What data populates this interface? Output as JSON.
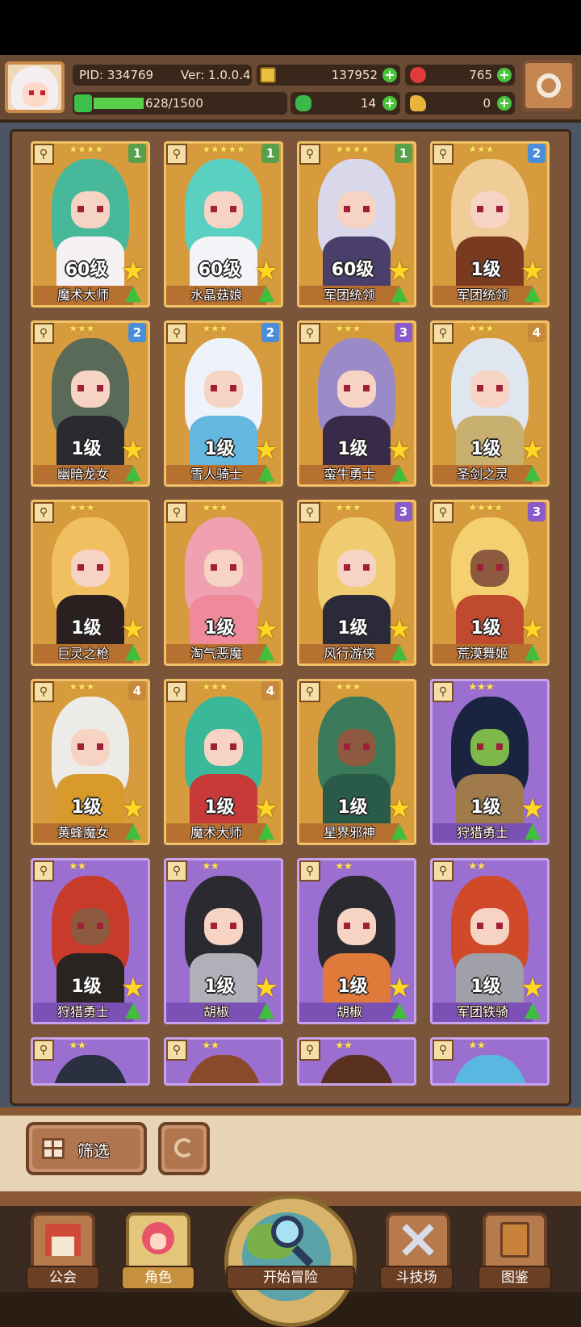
{
  "header": {
    "pid": "PID: 334769",
    "version": "Ver: 1.0.0.4",
    "gold": "137952",
    "gems": "765",
    "energy": "628/1500",
    "energy_fraction": 0.42,
    "clover": "14",
    "keys": "0"
  },
  "cards": [
    {
      "name": "魔术大师",
      "level": "60级",
      "tier": "1",
      "stars": "★★★★",
      "frame": "gold",
      "tier_color": "#58a04a",
      "hair": "#48b89a",
      "body": "#f4f0f4",
      "skin": "light"
    },
    {
      "name": "水晶菇娘",
      "level": "60级",
      "tier": "1",
      "stars": "★★★★★",
      "frame": "gold",
      "tier_color": "#58a04a",
      "hair": "#5ad0c0",
      "body": "#f4f4f8",
      "skin": "light"
    },
    {
      "name": "军团统领",
      "level": "60级",
      "tier": "1",
      "stars": "★★★★",
      "frame": "gold",
      "tier_color": "#58a04a",
      "hair": "#d8d8ea",
      "body": "#4a3f6a",
      "skin": "light"
    },
    {
      "name": "军团统领",
      "level": "1级",
      "tier": "2",
      "stars": "★★★",
      "frame": "gold",
      "tier_color": "#4a8ed8",
      "hair": "#f0cc96",
      "body": "#7a3a20",
      "skin": "light"
    },
    {
      "name": "幽暗龙女",
      "level": "1级",
      "tier": "2",
      "stars": "★★★",
      "frame": "gold",
      "tier_color": "#4a8ed8",
      "hair": "#5a6a58",
      "body": "#2a2a30",
      "skin": "light"
    },
    {
      "name": "雪人骑士",
      "level": "1级",
      "tier": "2",
      "stars": "★★★",
      "frame": "gold",
      "tier_color": "#4a8ed8",
      "hair": "#eef2fa",
      "body": "#64b8e0",
      "skin": "light"
    },
    {
      "name": "蛮牛勇士",
      "level": "1级",
      "tier": "3",
      "stars": "★★★",
      "frame": "gold",
      "tier_color": "#8a5ac8",
      "hair": "#9a8ac8",
      "body": "#3a2a4a",
      "skin": "light"
    },
    {
      "name": "圣剑之灵",
      "level": "1级",
      "tier": "4",
      "stars": "★★★",
      "frame": "gold",
      "tier_color": "#c88a3a",
      "hair": "#e0e6f0",
      "body": "#c8b070",
      "skin": "light"
    },
    {
      "name": "巨灵之枪",
      "level": "1级",
      "tier": "",
      "stars": "★★★",
      "frame": "gold",
      "tier_color": "#c88a3a",
      "hair": "#f0c060",
      "body": "#2a2020",
      "skin": "light"
    },
    {
      "name": "淘气恶魔",
      "level": "1级",
      "tier": "",
      "stars": "★★★",
      "frame": "gold",
      "tier_color": "#c88a3a",
      "hair": "#f0a0b0",
      "body": "#f08a9a",
      "skin": "light"
    },
    {
      "name": "风行游侠",
      "level": "1级",
      "tier": "3",
      "stars": "★★★",
      "frame": "gold",
      "tier_color": "#8a5ac8",
      "hair": "#f0cc70",
      "body": "#2a2a38",
      "skin": "light"
    },
    {
      "name": "荒漠舞姬",
      "level": "1级",
      "tier": "3",
      "stars": "★★★★",
      "frame": "gold",
      "tier_color": "#8a5ac8",
      "hair": "#f4d070",
      "body": "#c04a30",
      "skin": "dark"
    },
    {
      "name": "黄蜂魔女",
      "level": "1级",
      "tier": "4",
      "stars": "★★★",
      "frame": "gold",
      "tier_color": "#c88a3a",
      "hair": "#ecebe8",
      "body": "#d89a2a",
      "skin": "light"
    },
    {
      "name": "魔术大师",
      "level": "1级",
      "tier": "4",
      "stars": "★★★",
      "frame": "gold",
      "tier_color": "#c88a3a",
      "hair": "#3ab89a",
      "body": "#c83a3a",
      "skin": "light"
    },
    {
      "name": "星界邪神",
      "level": "1级",
      "tier": "",
      "stars": "★★★",
      "frame": "gold",
      "tier_color": "#6a5ad0",
      "hair": "#3a7a5a",
      "body": "#2a5a48",
      "skin": "dark"
    },
    {
      "name": "狩猎勇士",
      "level": "1级",
      "tier": "",
      "stars": "★★★",
      "frame": "purple",
      "tier_color": "#8a5ac8",
      "hair": "#1a2440",
      "body": "#a07a4a",
      "skin": "green"
    },
    {
      "name": "狩猎勇士",
      "level": "1级",
      "tier": "",
      "stars": "★★",
      "frame": "purple",
      "tier_color": "#8a5ac8",
      "hair": "#c83a2a",
      "body": "#2a2420",
      "skin": "dark"
    },
    {
      "name": "胡椒",
      "level": "1级",
      "tier": "",
      "stars": "★★",
      "frame": "purple",
      "tier_color": "#8a5ac8",
      "hair": "#2a2a30",
      "body": "#b0b0b8",
      "skin": "light"
    },
    {
      "name": "胡椒",
      "level": "1级",
      "tier": "",
      "stars": "★★",
      "frame": "purple",
      "tier_color": "#8a5ac8",
      "hair": "#2a2a30",
      "body": "#e07a3a",
      "skin": "light"
    },
    {
      "name": "军团铁骑",
      "level": "1级",
      "tier": "",
      "stars": "★★",
      "frame": "purple",
      "tier_color": "#8a5ac8",
      "hair": "#d04a2a",
      "body": "#a0a0a8",
      "skin": "light"
    }
  ],
  "partial_cards": [
    {
      "stars": "★★",
      "hair": "#2a3040"
    },
    {
      "stars": "★★",
      "hair": "#8a4a2a"
    },
    {
      "stars": "★★",
      "hair": "#5a3020"
    },
    {
      "stars": "★★",
      "hair": "#5ab8e0"
    }
  ],
  "controls": {
    "filter_label": "筛选"
  },
  "nav": {
    "guild": "公会",
    "character": "角色",
    "adventure": "开始冒险",
    "arena": "斗技场",
    "codex": "图鉴"
  }
}
